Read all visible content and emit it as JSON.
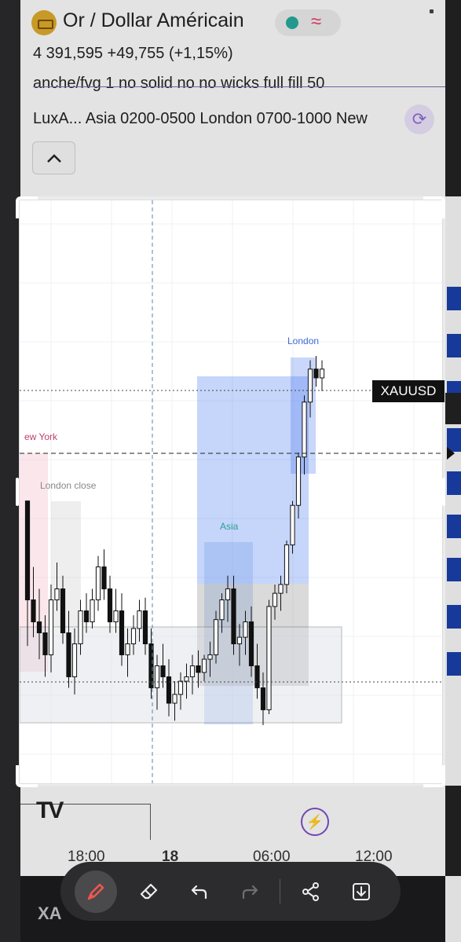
{
  "header": {
    "title": "Or / Dollar Américain",
    "price_line": "4 391,595  +49,755 (+1,15%)",
    "indicator_1": "anche/fvg 1 no solid no no wicks full fill 50",
    "indicator_2": "LuxA...  Asia 0200-0500 London 0700-1000 New",
    "collapse_icon": "chevron-up-icon",
    "refresh_icon": "refresh-icon",
    "status_icon": "status-dot-icon",
    "wave_icon": "wave-icon"
  },
  "chart": {
    "symbol_tag": "XAUUSD",
    "session_labels": {
      "london": "London",
      "asia": "Asia",
      "new_york": "ew York",
      "london_close": "London close"
    },
    "time_axis": [
      "18:00",
      "18",
      "06:00",
      "12:00"
    ],
    "colors": {
      "bull": "#ffffff",
      "bear": "#111111",
      "london_zone": "#4d7cf0",
      "asia_zone": "#6fa0e8",
      "ny_zone": "#f4b8c8",
      "neutral_zone": "#9e9e9e"
    }
  },
  "chart_data": {
    "type": "candlestick",
    "title": "",
    "series": [
      {
        "name": "",
        "values": [
          [
            0,
            1,
            0.62,
            0.34,
            0.55
          ],
          [
            1,
            0.55,
            0.7,
            0.38,
            0.45
          ],
          [
            2,
            0.45,
            0.6,
            0.28,
            0.4
          ],
          [
            3,
            0.4,
            0.48,
            0.2,
            0.3
          ],
          [
            4,
            0.3,
            0.62,
            0.22,
            0.55
          ],
          [
            5,
            0.55,
            0.72,
            0.5,
            0.6
          ],
          [
            6,
            0.6,
            0.66,
            0.35,
            0.4
          ],
          [
            7,
            0.4,
            0.5,
            0.15,
            0.2
          ],
          [
            8,
            0.2,
            0.42,
            0.12,
            0.35
          ],
          [
            9,
            0.35,
            0.55,
            0.3,
            0.5
          ],
          [
            10,
            0.5,
            0.58,
            0.4,
            0.45
          ],
          [
            11,
            0.45,
            0.6,
            0.42,
            0.55
          ],
          [
            12,
            0.55,
            0.75,
            0.5,
            0.7
          ],
          [
            13,
            0.7,
            0.78,
            0.55,
            0.6
          ],
          [
            14,
            0.6,
            0.66,
            0.4,
            0.45
          ],
          [
            15,
            0.45,
            0.6,
            0.4,
            0.5
          ],
          [
            16,
            0.5,
            0.58,
            0.25,
            0.3
          ],
          [
            17,
            0.3,
            0.42,
            0.2,
            0.35
          ],
          [
            18,
            0.35,
            0.48,
            0.3,
            0.42
          ],
          [
            19,
            0.42,
            0.55,
            0.36,
            0.5
          ],
          [
            20,
            0.5,
            0.56,
            0.3,
            0.35
          ],
          [
            21,
            0.35,
            0.42,
            0.1,
            0.15
          ],
          [
            22,
            0.15,
            0.3,
            0.05,
            0.25
          ],
          [
            23,
            0.25,
            0.35,
            0.15,
            0.2
          ],
          [
            24,
            0.2,
            0.28,
            0.02,
            0.08
          ],
          [
            25,
            0.08,
            0.18,
            0.0,
            0.12
          ],
          [
            26,
            0.12,
            0.22,
            0.05,
            0.18
          ],
          [
            27,
            0.18,
            0.26,
            0.1,
            0.2
          ],
          [
            28,
            0.2,
            0.3,
            0.12,
            0.25
          ],
          [
            29,
            0.25,
            0.32,
            0.15,
            0.22
          ],
          [
            30,
            0.22,
            0.3,
            0.18,
            0.28
          ],
          [
            31,
            0.28,
            0.36,
            0.2,
            0.3
          ],
          [
            32,
            0.3,
            0.5,
            0.26,
            0.46
          ],
          [
            33,
            0.46,
            0.58,
            0.4,
            0.55
          ],
          [
            34,
            0.55,
            0.66,
            0.45,
            0.6
          ],
          [
            35,
            0.6,
            0.66,
            0.3,
            0.35
          ],
          [
            36,
            0.35,
            0.44,
            0.25,
            0.38
          ],
          [
            37,
            0.38,
            0.5,
            0.3,
            0.45
          ],
          [
            38,
            0.45,
            0.52,
            0.2,
            0.25
          ],
          [
            39,
            0.25,
            0.35,
            0.1,
            0.15
          ],
          [
            40,
            0.15,
            0.22,
            -0.02,
            0.05
          ],
          [
            41,
            0.05,
            0.55,
            0.03,
            0.52
          ],
          [
            42,
            0.52,
            0.62,
            0.46,
            0.58
          ],
          [
            43,
            0.58,
            0.66,
            0.5,
            0.62
          ],
          [
            44,
            0.62,
            0.82,
            0.58,
            0.8
          ],
          [
            45,
            0.8,
            1.0,
            0.76,
            0.98
          ],
          [
            46,
            0.98,
            1.22,
            0.92,
            1.2
          ],
          [
            47,
            1.2,
            1.48,
            1.12,
            1.45
          ],
          [
            48,
            1.45,
            1.64,
            1.38,
            1.6
          ],
          [
            49,
            1.6,
            1.66,
            1.52,
            1.56
          ],
          [
            50,
            1.56,
            1.64,
            1.5,
            1.6
          ]
        ]
      }
    ]
  },
  "bottom": {
    "flash_icon": "flash-icon",
    "logo_icon": "tradingview-logo-icon"
  },
  "toolbar": {
    "items": [
      {
        "icon": "pen-icon",
        "active": true
      },
      {
        "icon": "eraser-icon",
        "active": false
      },
      {
        "icon": "undo-icon",
        "active": false
      },
      {
        "icon": "redo-icon",
        "active": false
      },
      {
        "icon": "share-icon",
        "active": false
      },
      {
        "icon": "download-icon",
        "active": false
      }
    ]
  }
}
